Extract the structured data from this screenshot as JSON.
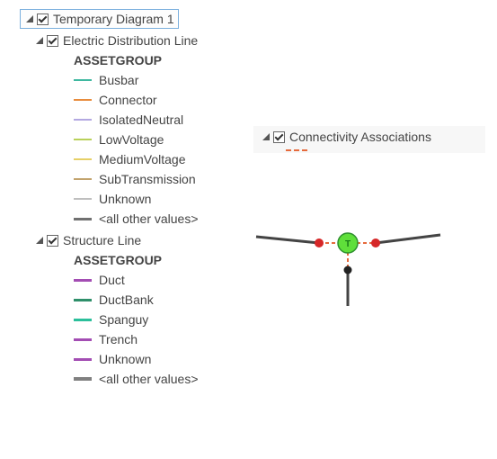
{
  "tree": {
    "root": {
      "label": "Temporary Diagram 1",
      "checked": true
    },
    "layers": [
      {
        "label": "Electric Distribution Line",
        "checked": true,
        "heading": "ASSETGROUP",
        "items": [
          {
            "label": "Busbar",
            "color": "#3fb8a0",
            "weight": "thin"
          },
          {
            "label": "Connector",
            "color": "#e88c3d",
            "weight": "thin"
          },
          {
            "label": "IsolatedNeutral",
            "color": "#b3a8e1",
            "weight": "thin"
          },
          {
            "label": "LowVoltage",
            "color": "#b9d15a",
            "weight": "thin"
          },
          {
            "label": "MediumVoltage",
            "color": "#e6d067",
            "weight": "thin"
          },
          {
            "label": "SubTransmission",
            "color": "#c2a36d",
            "weight": "thin"
          },
          {
            "label": "Unknown",
            "color": "#bfbfbf",
            "weight": "thin"
          },
          {
            "label": "<all other values>",
            "color": "#707070",
            "weight": "thick"
          }
        ]
      },
      {
        "label": "Structure Line",
        "checked": true,
        "heading": "ASSETGROUP",
        "items": [
          {
            "label": "Duct",
            "color": "#a34db3",
            "weight": "thick"
          },
          {
            "label": "DuctBank",
            "color": "#2e8f6a",
            "weight": "thick"
          },
          {
            "label": "Spanguy",
            "color": "#2bbf9b",
            "weight": "thick"
          },
          {
            "label": "Trench",
            "color": "#a34db3",
            "weight": "thick"
          },
          {
            "label": "Unknown",
            "color": "#a34db3",
            "weight": "thick"
          },
          {
            "label": "<all other values>",
            "color": "#808080",
            "weight": "thicker"
          }
        ]
      }
    ]
  },
  "connectivity": {
    "label": "Connectivity Associations",
    "checked": true
  }
}
